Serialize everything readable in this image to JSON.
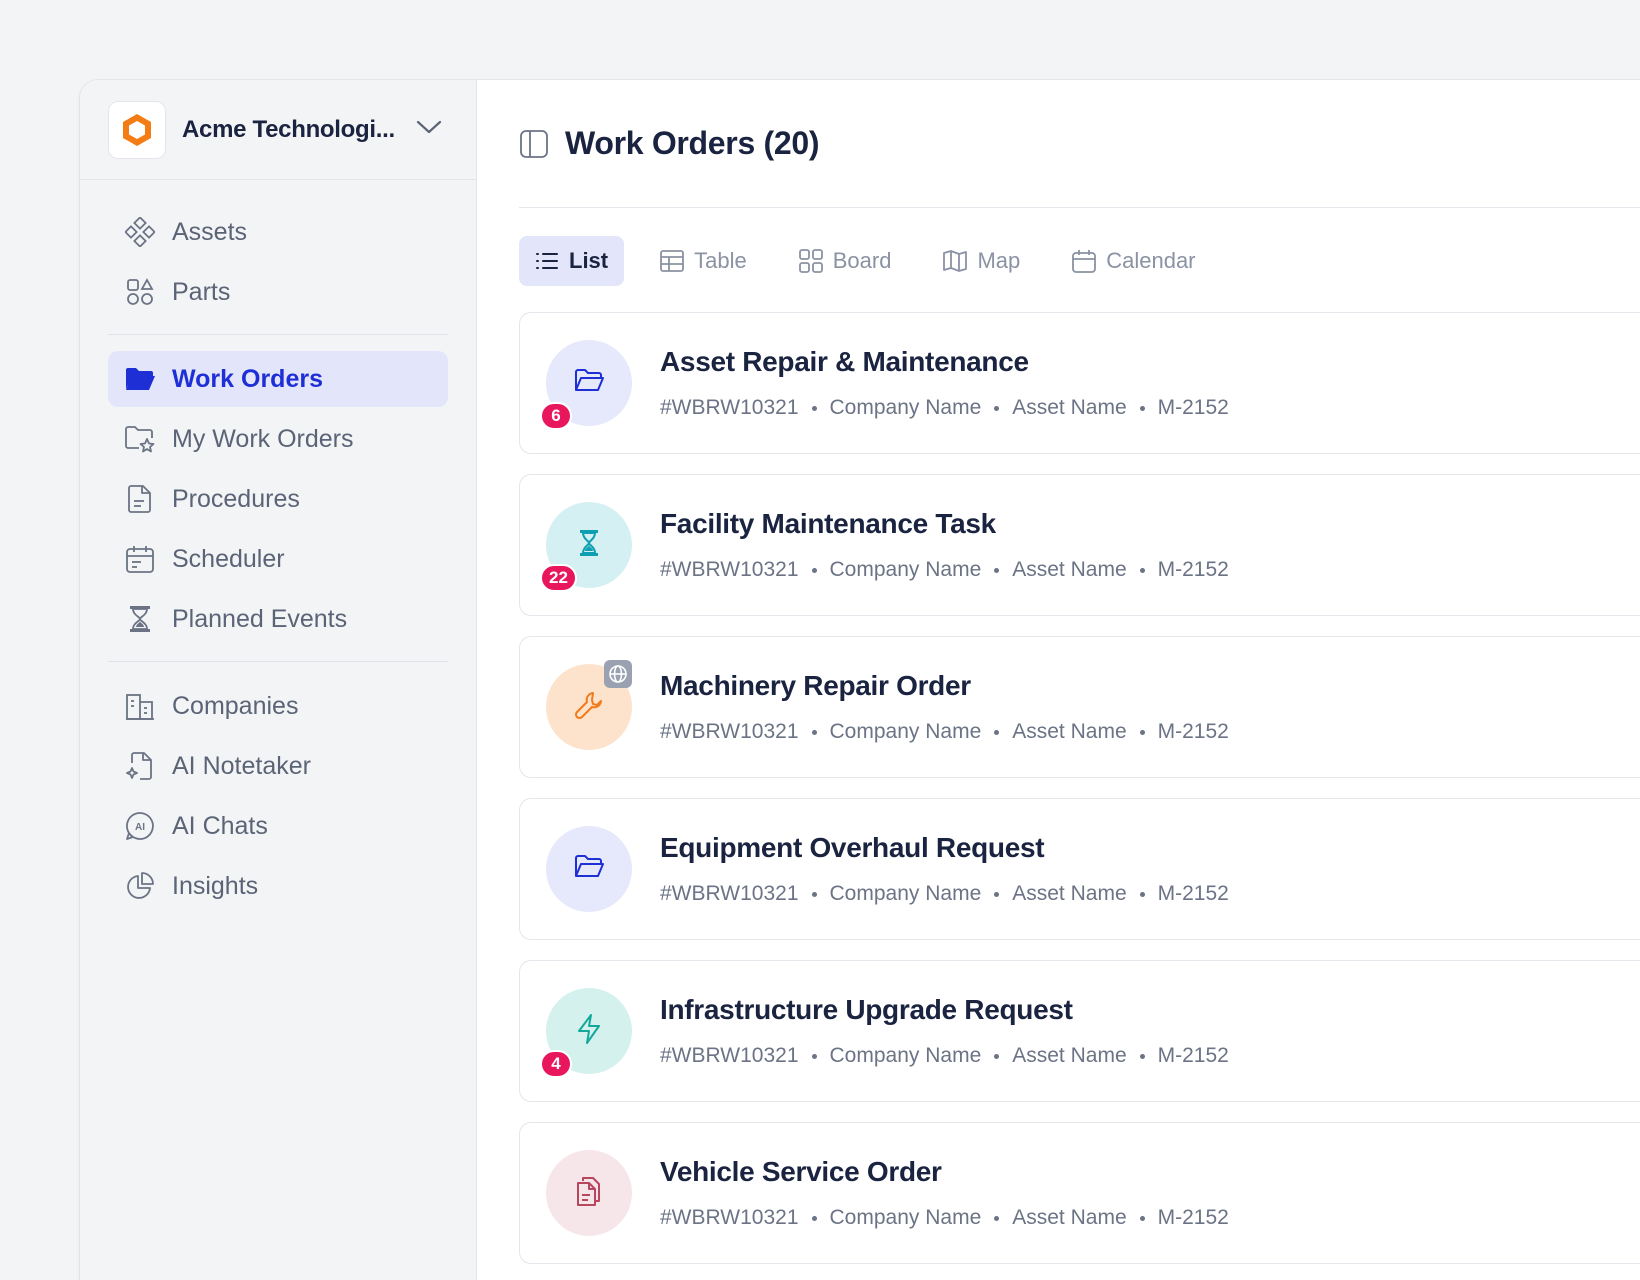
{
  "org": {
    "name": "Acme Technologi..."
  },
  "sidebar": {
    "items": [
      {
        "label": "Assets",
        "icon": "assets-icon"
      },
      {
        "label": "Parts",
        "icon": "parts-icon"
      },
      {
        "label": "Work Orders",
        "icon": "folder-open-icon",
        "active": true
      },
      {
        "label": "My Work Orders",
        "icon": "folder-star-icon"
      },
      {
        "label": "Procedures",
        "icon": "document-icon"
      },
      {
        "label": "Scheduler",
        "icon": "calendar-icon"
      },
      {
        "label": "Planned Events",
        "icon": "hourglass-icon"
      },
      {
        "label": "Companies",
        "icon": "building-icon"
      },
      {
        "label": "AI Notetaker",
        "icon": "note-sparkle-icon"
      },
      {
        "label": "AI Chats",
        "icon": "ai-chat-icon"
      },
      {
        "label": "Insights",
        "icon": "pie-chart-icon"
      }
    ]
  },
  "header": {
    "title": "Work Orders (20)"
  },
  "tabs": [
    {
      "label": "List",
      "active": true
    },
    {
      "label": "Table"
    },
    {
      "label": "Board"
    },
    {
      "label": "Map"
    },
    {
      "label": "Calendar"
    }
  ],
  "work_orders": [
    {
      "title": "Asset Repair & Maintenance",
      "id": "#WBRW10321",
      "company": "Company Name",
      "asset": "Asset Name",
      "code": "M-2152",
      "badge": "6",
      "icon": "folder-open-icon",
      "color": "#1f2fd6",
      "bg": "#e6e8fb"
    },
    {
      "title": "Facility Maintenance Task",
      "id": "#WBRW10321",
      "company": "Company Name",
      "asset": "Asset Name",
      "code": "M-2152",
      "badge": "22",
      "icon": "hourglass-icon",
      "color": "#0e9fb0",
      "bg": "#d5f0f3"
    },
    {
      "title": "Machinery Repair Order",
      "id": "#WBRW10321",
      "company": "Company Name",
      "asset": "Asset Name",
      "code": "M-2152",
      "icon": "wrench-icon",
      "color": "#f27a1a",
      "bg": "#fde3cc",
      "globe": true
    },
    {
      "title": "Equipment Overhaul Request",
      "id": "#WBRW10321",
      "company": "Company Name",
      "asset": "Asset Name",
      "code": "M-2152",
      "icon": "folder-open-icon",
      "color": "#1f2fd6",
      "bg": "#e6e8fb"
    },
    {
      "title": "Infrastructure Upgrade Request",
      "id": "#WBRW10321",
      "company": "Company Name",
      "asset": "Asset Name",
      "code": "M-2152",
      "badge": "4",
      "icon": "lightning-icon",
      "color": "#13a99a",
      "bg": "#d4f1ee"
    },
    {
      "title": "Vehicle Service Order",
      "id": "#WBRW10321",
      "company": "Company Name",
      "asset": "Asset Name",
      "code": "M-2152",
      "icon": "documents-icon",
      "color": "#b8475e",
      "bg": "#f6e6ea"
    }
  ]
}
